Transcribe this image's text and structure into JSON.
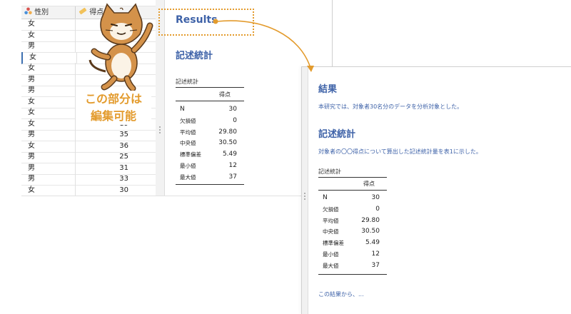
{
  "sheet": {
    "columns": [
      {
        "label": "性別",
        "icon": "nominal-variable-icon"
      },
      {
        "label": "得点",
        "icon": "ruler-variable-icon"
      }
    ],
    "rows": [
      {
        "gender": "女",
        "score": ""
      },
      {
        "gender": "女",
        "score": ""
      },
      {
        "gender": "男",
        "score": ""
      },
      {
        "gender": "女",
        "score": ""
      },
      {
        "gender": "女",
        "score": ""
      },
      {
        "gender": "男",
        "score": "2"
      },
      {
        "gender": "男",
        "score": ""
      },
      {
        "gender": "女",
        "score": ""
      },
      {
        "gender": "女",
        "score": ""
      },
      {
        "gender": "女",
        "score": "19"
      },
      {
        "gender": "男",
        "score": "35"
      },
      {
        "gender": "女",
        "score": "36"
      },
      {
        "gender": "男",
        "score": "25"
      },
      {
        "gender": "男",
        "score": "31"
      },
      {
        "gender": "男",
        "score": "33"
      },
      {
        "gender": "女",
        "score": "30"
      }
    ]
  },
  "results_pane": {
    "title": "Results",
    "section": "記述統計",
    "table_caption": "記述統計",
    "column_header": "得点",
    "stats": [
      {
        "label": "N",
        "value": "30"
      },
      {
        "label": "欠損値",
        "value": "0"
      },
      {
        "label": "平均値",
        "value": "29.80"
      },
      {
        "label": "中央値",
        "value": "30.50"
      },
      {
        "label": "標準偏差",
        "value": "5.49"
      },
      {
        "label": "最小値",
        "value": "12"
      },
      {
        "label": "最大値",
        "value": "37"
      }
    ]
  },
  "annotation": {
    "line1": "この部分は",
    "line2": "編集可能",
    "color": "#e39b2d"
  },
  "front": {
    "title": "結果",
    "intro": "本研究では、対象者30名分のデータを分析対象とした。",
    "section": "記述統計",
    "section_text": "対象者の〇〇得点について算出した記述統計量を表1に示した。",
    "table_caption": "記述統計",
    "column_header": "得点",
    "stats": [
      {
        "label": "N",
        "value": "30"
      },
      {
        "label": "欠損値",
        "value": "0"
      },
      {
        "label": "平均値",
        "value": "29.80"
      },
      {
        "label": "中央値",
        "value": "30.50"
      },
      {
        "label": "標準偏差",
        "value": "5.49"
      },
      {
        "label": "最小値",
        "value": "12"
      },
      {
        "label": "最大値",
        "value": "37"
      }
    ],
    "footer": "この結果から、..."
  },
  "colors": {
    "accent_blue": "#3e62a8",
    "annotation_orange": "#e39b2d"
  }
}
